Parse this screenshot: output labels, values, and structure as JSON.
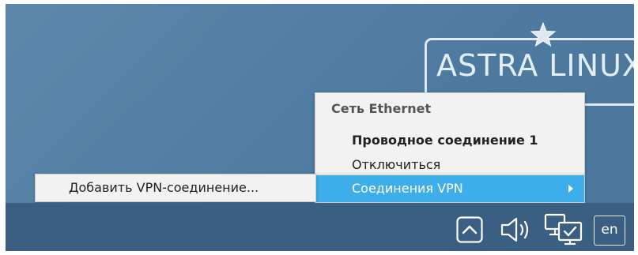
{
  "desktop": {
    "logo_text": "ASTRA LINUX"
  },
  "network_menu": {
    "section_title": "Сеть Ethernet",
    "items": [
      {
        "label": "Проводное соединение 1",
        "bold": true
      },
      {
        "label": "Отключиться"
      },
      {
        "label": "Соединения VPN",
        "highlighted": true,
        "has_submenu": true
      }
    ]
  },
  "vpn_submenu": {
    "items": [
      {
        "label": "Добавить VPN-соединение..."
      }
    ]
  },
  "taskbar": {
    "tray_icons": [
      "chevron-up-icon",
      "speaker-icon",
      "network-icon"
    ],
    "language": "en"
  },
  "colors": {
    "highlight": "#3daee9",
    "desktop": "#5d87ab",
    "taskbar": "#3a5f82",
    "menu_bg": "#f2f2f2"
  }
}
